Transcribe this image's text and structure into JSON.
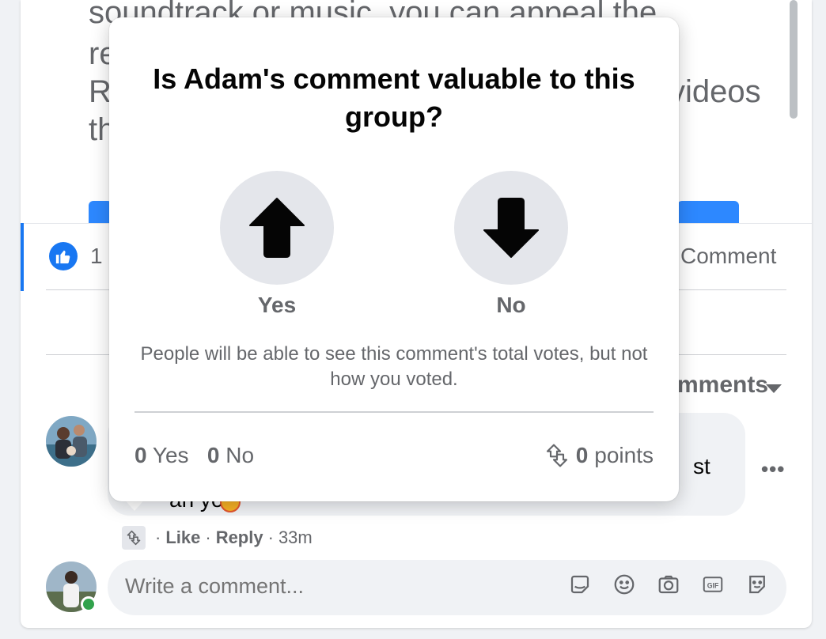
{
  "post": {
    "line1": "soundtrack or music, you can appeal the",
    "line2": "re",
    "line3_start": "R",
    "line3_end": "videos",
    "line4": "th"
  },
  "reactions": {
    "like_count": "1",
    "comment_action": "Comment"
  },
  "comments": {
    "sort_label": "mments",
    "bubble_tail_text": "st",
    "bubble_fragment": "ah you",
    "more_label": "•••",
    "actions": {
      "like": "Like",
      "reply": "Reply",
      "time": "33m"
    }
  },
  "composer": {
    "placeholder": "Write a comment..."
  },
  "vote_popup": {
    "title": "Is Adam's comment valuable to this group?",
    "yes_label": "Yes",
    "no_label": "No",
    "note": "People will be able to see this comment's total votes, but not how you voted.",
    "yes_count": "0",
    "yes_word": "Yes",
    "no_count": "0",
    "no_word": "No",
    "points_count": "0",
    "points_word": "points"
  },
  "colors": {
    "accent": "#1877f2",
    "secondary_text": "#65676b",
    "button_gray": "#e4e6eb",
    "online": "#31a24c"
  },
  "icons": [
    "like-thumb-icon",
    "up-arrow-icon",
    "down-arrow-icon",
    "vote-arrows-icon",
    "sticker-icon",
    "emoji-icon",
    "camera-icon",
    "gif-icon",
    "avatar-sticker-icon",
    "caret-down-icon"
  ]
}
